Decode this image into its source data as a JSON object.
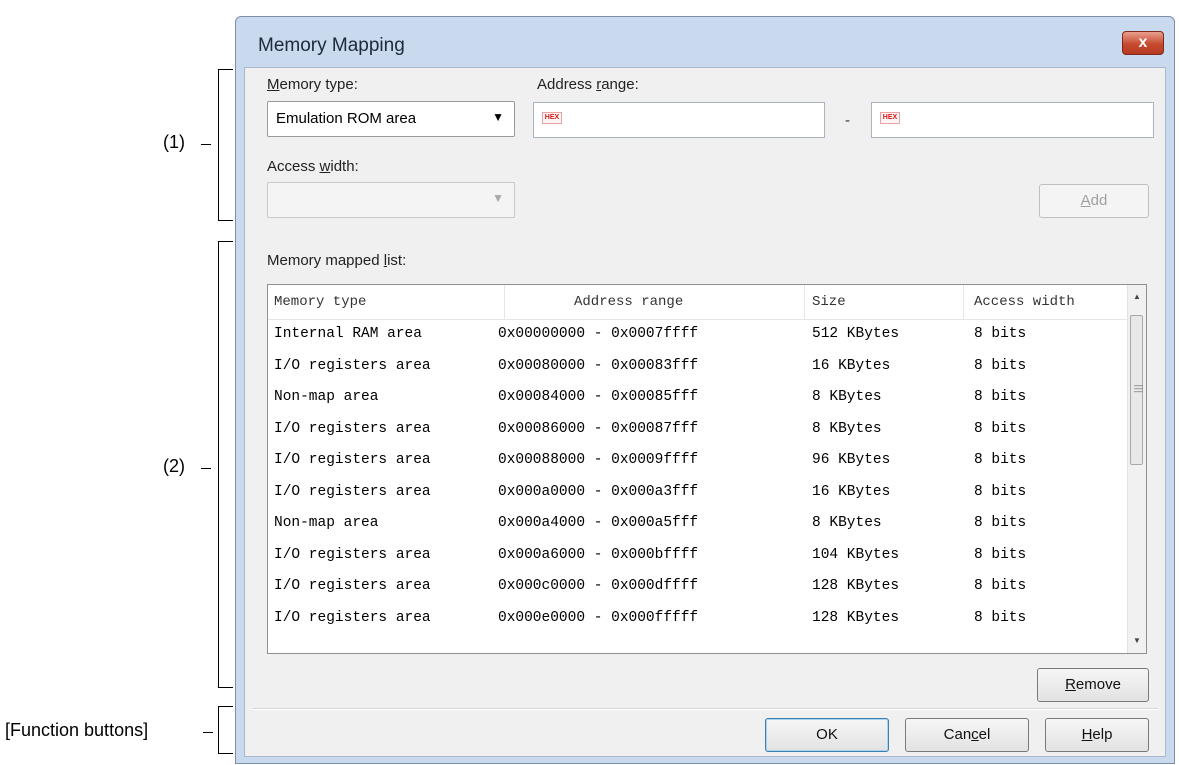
{
  "annotations": {
    "section1": "(1)",
    "section2": "(2)",
    "function_buttons": "[Function buttons]"
  },
  "dialog": {
    "title": "Memory Mapping",
    "close_glyph": "x"
  },
  "memory_type": {
    "label_first": "M",
    "label_rest": "emory type:",
    "selected": "Emulation ROM area"
  },
  "address_range": {
    "label_pre": "Address ",
    "label_u": "r",
    "label_post": "ange:",
    "start_value": "",
    "end_value": "",
    "separator": "-",
    "hex_badge": "HEX"
  },
  "access_width": {
    "label_pre": "Access ",
    "label_u": "w",
    "label_post": "idth:",
    "selected": ""
  },
  "add_button": {
    "label_u": "A",
    "label_rest": "dd"
  },
  "list": {
    "label_pre": "Memory mapped ",
    "label_u": "l",
    "label_post": "ist:",
    "columns": [
      "Memory type",
      "Address range",
      "Size",
      "Access width"
    ],
    "rows": [
      [
        "Internal RAM area",
        "0x00000000 - 0x0007ffff",
        "512 KBytes",
        "8 bits"
      ],
      [
        "I/O registers area",
        "0x00080000 - 0x00083fff",
        "16 KBytes",
        "8 bits"
      ],
      [
        "Non-map area",
        "0x00084000 - 0x00085fff",
        "8 KBytes",
        "8 bits"
      ],
      [
        "I/O registers area",
        "0x00086000 - 0x00087fff",
        "8 KBytes",
        "8 bits"
      ],
      [
        "I/O registers area",
        "0x00088000 - 0x0009ffff",
        "96 KBytes",
        "8 bits"
      ],
      [
        "I/O registers area",
        "0x000a0000 - 0x000a3fff",
        "16 KBytes",
        "8 bits"
      ],
      [
        "Non-map area",
        "0x000a4000 - 0x000a5fff",
        "8 KBytes",
        "8 bits"
      ],
      [
        "I/O registers area",
        "0x000a6000 - 0x000bffff",
        "104 KBytes",
        "8 bits"
      ],
      [
        "I/O registers area",
        "0x000c0000 - 0x000dffff",
        "128 KBytes",
        "8 bits"
      ],
      [
        "I/O registers area",
        "0x000e0000 - 0x000fffff",
        "128 KBytes",
        "8 bits"
      ]
    ]
  },
  "remove_button": {
    "label_u": "R",
    "label_rest": "emove"
  },
  "buttons": {
    "ok": "OK",
    "cancel_pre": "Can",
    "cancel_u": "c",
    "cancel_post": "el",
    "help_u": "H",
    "help_rest": "elp"
  },
  "colors": {
    "frame": "#c9d9ee",
    "close": "#c74a2f",
    "hex_badge": "#d21a1a"
  }
}
